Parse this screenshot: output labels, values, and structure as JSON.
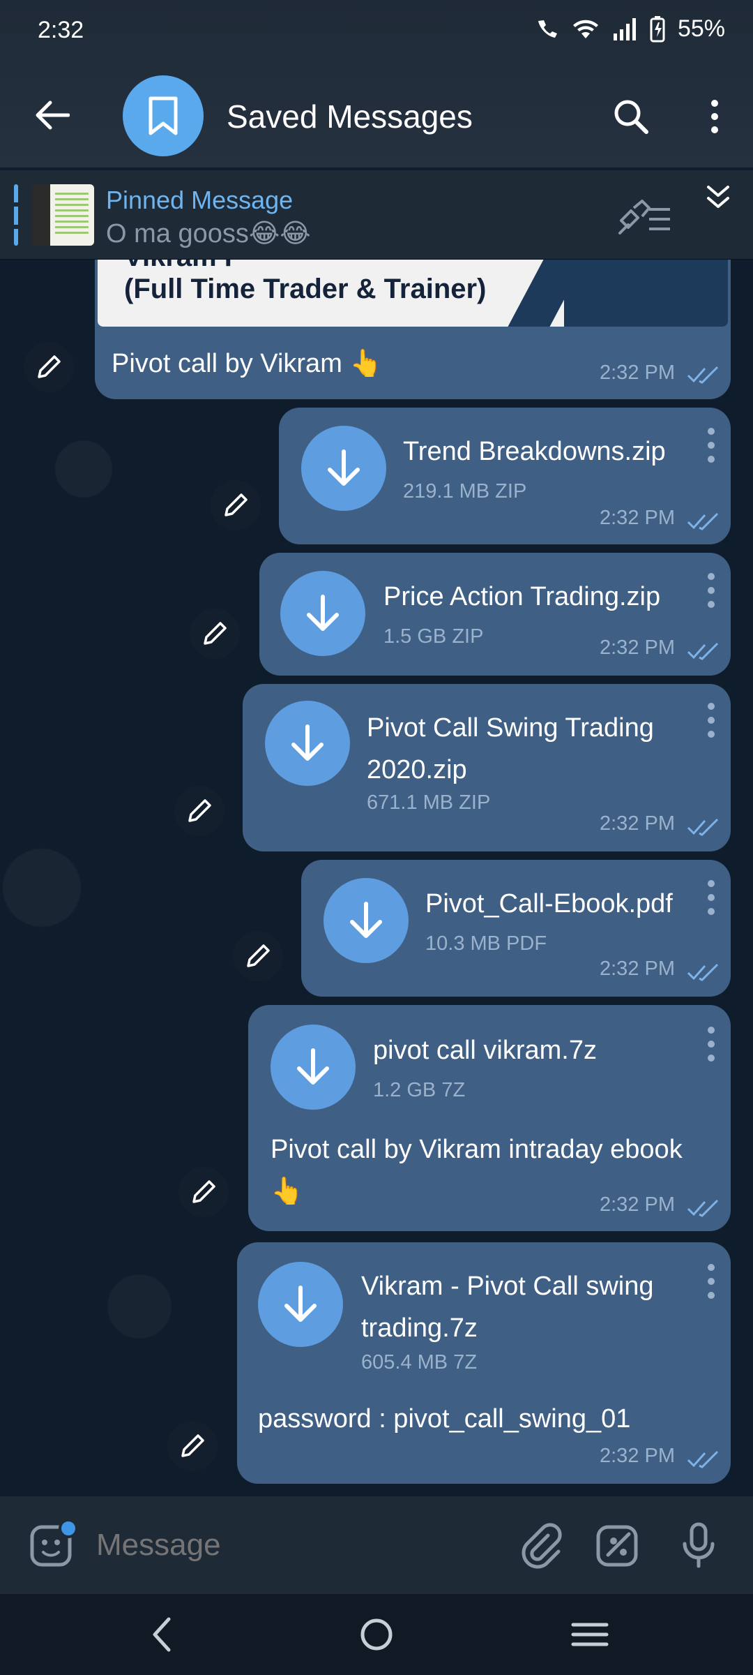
{
  "status_bar": {
    "time": "2:32",
    "battery": "55%"
  },
  "header": {
    "title": "Saved Messages"
  },
  "pinned": {
    "title": "Pinned Message",
    "text": "O ma gooss😂😂"
  },
  "banner": {
    "line1": "Vikram P",
    "line2": "(Full Time Trader & Trainer)"
  },
  "messages": [
    {
      "caption": "Pivot call by Vikram 👆",
      "time": "2:32 PM"
    },
    {
      "file": "Trend Breakdowns.zip",
      "size": "219.1 MB ZIP",
      "time": "2:32 PM"
    },
    {
      "file": "Price Action Trading.zip",
      "size": "1.5 GB ZIP",
      "time": "2:32 PM"
    },
    {
      "file_line1": "Pivot Call Swing Trading",
      "file_line2": "2020.zip",
      "size": "671.1 MB ZIP",
      "time": "2:32 PM"
    },
    {
      "file": "Pivot_Call-Ebook.pdf",
      "size": "10.3 MB PDF",
      "time": "2:32 PM"
    },
    {
      "file": "pivot call vikram.7z",
      "size": "1.2 GB 7Z",
      "caption_line1": "Pivot call by Vikram intraday ebook",
      "caption_line2": "👆",
      "time": "2:32 PM"
    },
    {
      "file_line1": "Vikram - Pivot Call swing",
      "file_line2": "trading.7z",
      "size": "605.4 MB 7Z",
      "caption": "password : pivot_call_swing_01",
      "time": "2:32 PM"
    }
  ],
  "composer": {
    "placeholder": "Message"
  },
  "colors": {
    "accent": "#5aa9ec",
    "bubble": "#3f5f85",
    "background": "#0f1c2b"
  }
}
